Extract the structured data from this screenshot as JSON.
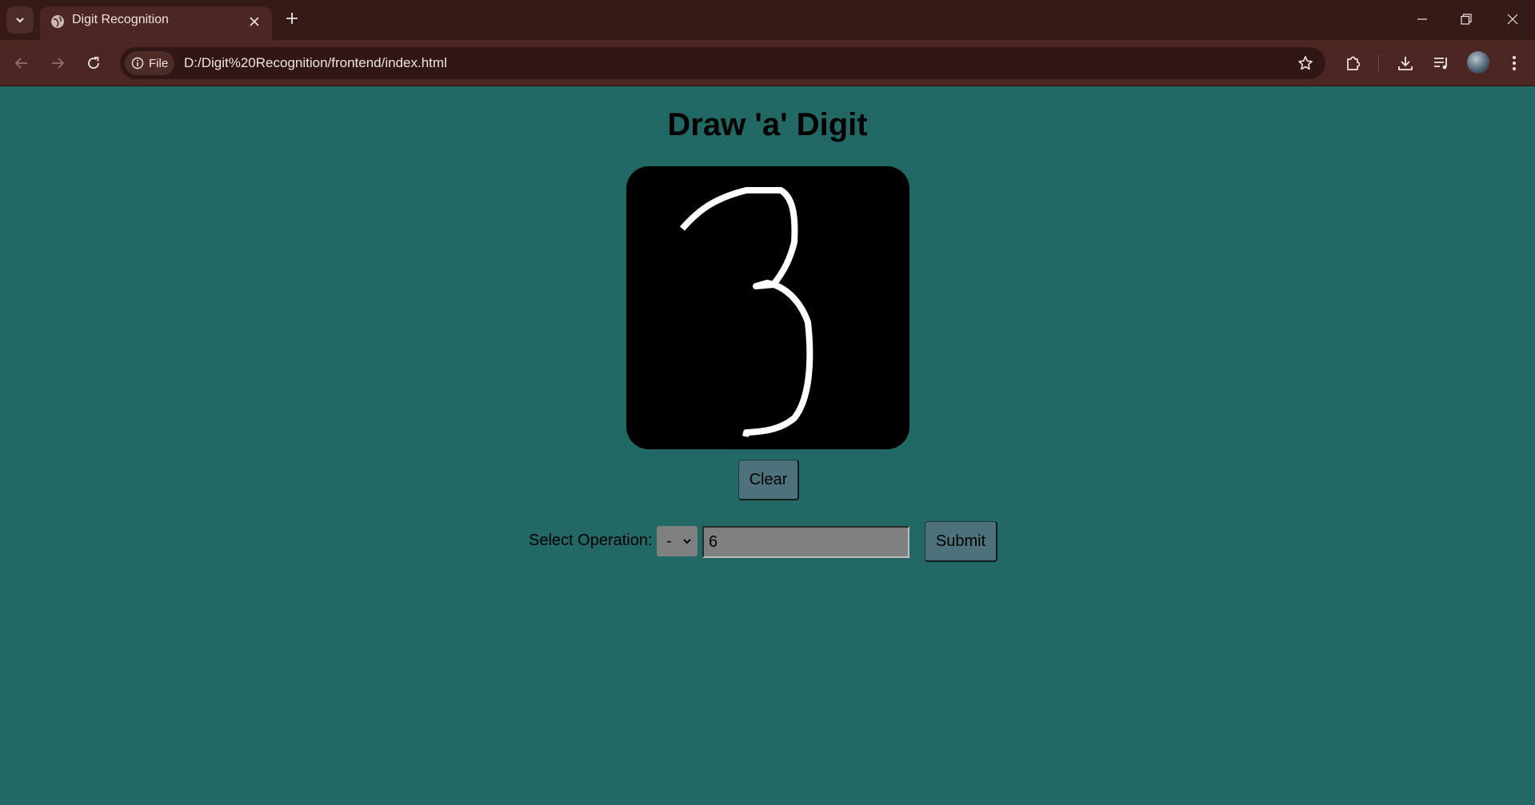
{
  "browser": {
    "tab_title": "Digit Recognition",
    "site_chip_label": "File",
    "url": "D:/Digit%20Recognition/frontend/index.html"
  },
  "page": {
    "heading": "Draw 'a' Digit",
    "clear_label": "Clear",
    "operation_label": "Select Operation:",
    "operation_selected": "-",
    "number_value": "6",
    "submit_label": "Submit"
  },
  "colors": {
    "page_background": "#226865",
    "canvas_background": "#000000",
    "stroke": "#ffffff",
    "button_background": "#4d727b",
    "input_background": "#7e817f",
    "chrome_dark": "#351a17",
    "chrome_toolbar": "#4b2622"
  },
  "icons": [
    "tab-search-icon",
    "globe-icon",
    "close-icon",
    "plus-icon",
    "minimize-icon",
    "restore-icon",
    "window-close-icon",
    "back-icon",
    "forward-icon",
    "reload-icon",
    "info-icon",
    "star-icon",
    "extensions-icon",
    "download-icon",
    "media-icon",
    "menu-icon"
  ]
}
